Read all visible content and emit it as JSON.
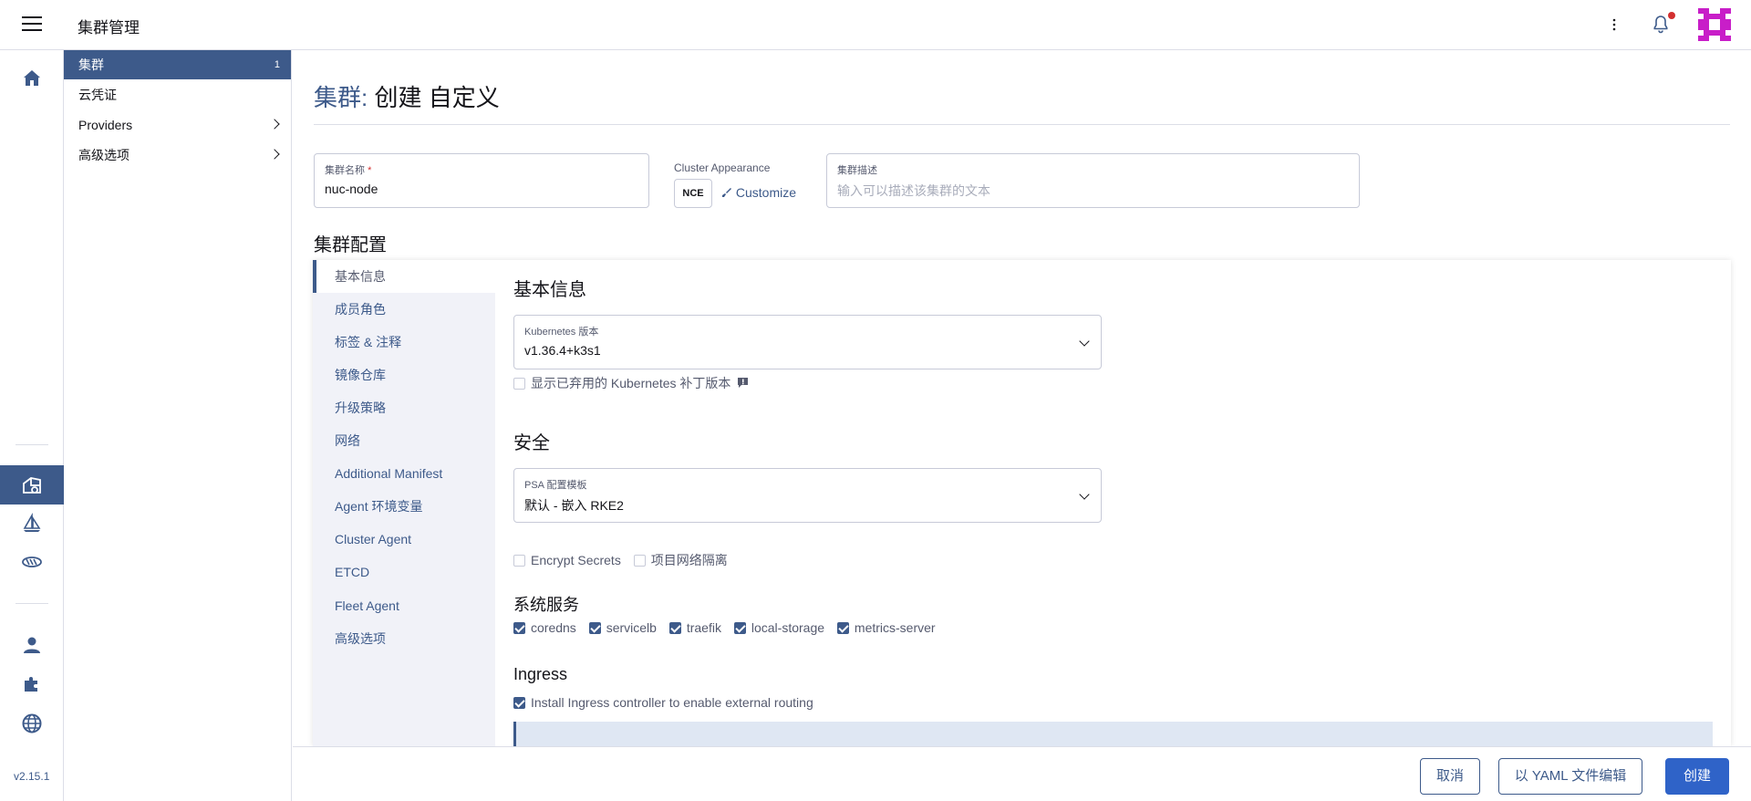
{
  "header": {
    "title": "集群管理"
  },
  "sidebar": {
    "version": "v2.15.1",
    "items": [
      {
        "label": "集群",
        "count": "1"
      },
      {
        "label": "云凭证"
      },
      {
        "label": "Providers"
      },
      {
        "label": "高级选项"
      }
    ]
  },
  "page": {
    "crumb": "集群:",
    "title": "创建 自定义",
    "cluster_name": {
      "label": "集群名称",
      "required_mark": "*",
      "value": "nuc-node"
    },
    "appearance": {
      "label": "Cluster Appearance",
      "badge": "NCE",
      "customize": "Customize"
    },
    "description": {
      "label": "集群描述",
      "placeholder": "输入可以描述该集群的文本"
    },
    "config_title": "集群配置"
  },
  "tabs": [
    "基本信息",
    "成员角色",
    "标签 & 注释",
    "镜像仓库",
    "升级策略",
    "网络",
    "Additional Manifest",
    "Agent 环境变量",
    "Cluster Agent",
    "ETCD",
    "Fleet Agent",
    "高级选项"
  ],
  "basic": {
    "title": "基本信息",
    "k8s_label": "Kubernetes 版本",
    "k8s_value": "v1.36.4+k3s1",
    "deprecated_label": "显示已弃用的 Kubernetes 补丁版本"
  },
  "security": {
    "title": "安全",
    "psa_label": "PSA 配置模板",
    "psa_value": "默认 - 嵌入 RKE2",
    "encrypt_label": "Encrypt Secrets",
    "isolation_label": "项目网络隔离"
  },
  "system_services": {
    "title": "系统服务",
    "items": [
      "coredns",
      "servicelb",
      "traefik",
      "local-storage",
      "metrics-server"
    ]
  },
  "ingress": {
    "title": "Ingress",
    "controller_label": "Install Ingress controller to enable external routing"
  },
  "footer": {
    "cancel": "取消",
    "yaml": "以 YAML 文件编辑",
    "create": "创建"
  },
  "colors": {
    "accent": "#3d5a8a",
    "primary_button": "#2f63c8",
    "avatar": "#c81ec8"
  }
}
